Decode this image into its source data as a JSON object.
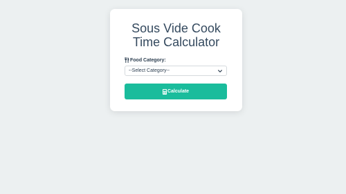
{
  "app": {
    "title_line1": "Sous Vide Cook",
    "title_line2": "Time Calculator"
  },
  "form": {
    "category_label": "Food Category:",
    "category_icon": "utensils-icon",
    "category_selected": "--Select Category--",
    "calculate_label": "Calculate",
    "calculate_icon": "calculator-icon"
  },
  "colors": {
    "background": "#ecf0f1",
    "card": "#ffffff",
    "title": "#34495e",
    "accent": "#1abc9c"
  }
}
